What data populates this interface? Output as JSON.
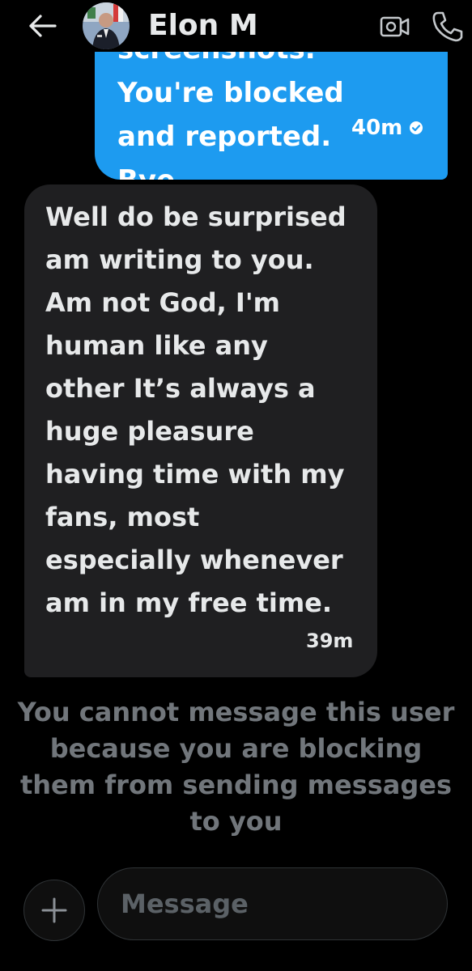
{
  "header": {
    "contact_name": "Elon M",
    "icons": {
      "back": "arrow-left-icon",
      "video": "video-camera-icon",
      "call": "phone-icon"
    }
  },
  "messages": [
    {
      "direction": "outgoing",
      "text": "screenshots. You're blocked and reported. Bye.",
      "time": "40m",
      "status_icon": "checkmark-circle-icon"
    },
    {
      "direction": "incoming",
      "text": "Well do be surprised am writing to you. Am not God, I'm human like any other It’s always a huge pleasure having time with my fans, most especially whenever am in my free time.",
      "time": "39m"
    }
  ],
  "blocked_notice": "You cannot message this user because you are blocking them from sending messages to you",
  "composer": {
    "placeholder": "Message",
    "add_icon": "plus-icon"
  },
  "colors": {
    "background": "#000000",
    "outgoing_bubble": "#1d9bf0",
    "incoming_bubble": "#1f1f21",
    "muted_text": "#71767b",
    "primary_text": "#e7e9ea"
  }
}
